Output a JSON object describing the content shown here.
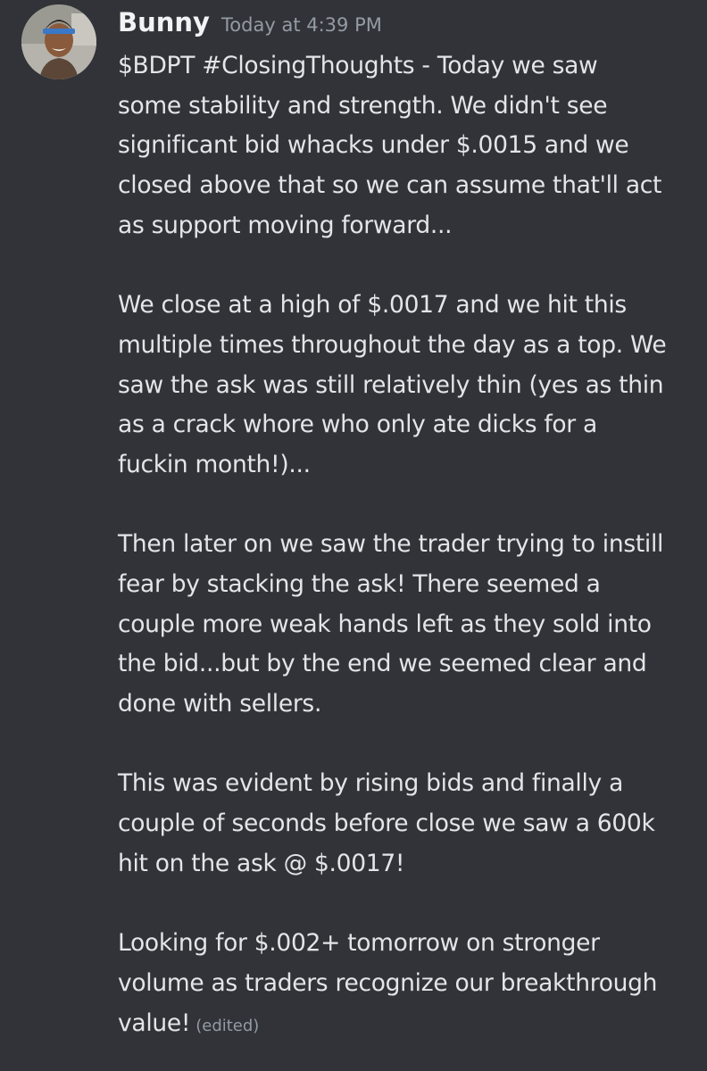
{
  "message": {
    "author": "Bunny",
    "timestamp": "Today at 4:39 PM",
    "edited_label": "(edited)",
    "lines": [
      "$BDPT #ClosingThoughts - Today we saw",
      "some stability and strength. We didn't see",
      "significant bid whacks under $.0015 and we",
      "closed above that so we can assume that'll act",
      "as support moving forward...",
      "",
      "We close at a high of $.0017 and we hit this",
      "multiple times throughout the day as a top. We",
      "saw the ask was still relatively thin (yes as thin",
      "as a crack whore who only ate dicks for a",
      "fuckin month!)...",
      "",
      "Then later on we saw the trader trying to instill",
      "fear by stacking the ask! There seemed a",
      "couple more weak hands left as they sold into",
      "the bid...but by the end we seemed clear and",
      "done with sellers.",
      "",
      "This was evident by rising bids and finally a",
      "couple of seconds before close we saw a 600k",
      "hit on the ask @ $.0017!",
      "",
      "Looking for $.002+ tomorrow on stronger",
      "volume as traders recognize our breakthrough",
      "value!"
    ]
  },
  "colors": {
    "background": "#313338",
    "author": "#f2f3f5",
    "text": "#e3e5e8",
    "muted": "#949ba4"
  },
  "icons": {
    "avatar": "user-avatar"
  }
}
